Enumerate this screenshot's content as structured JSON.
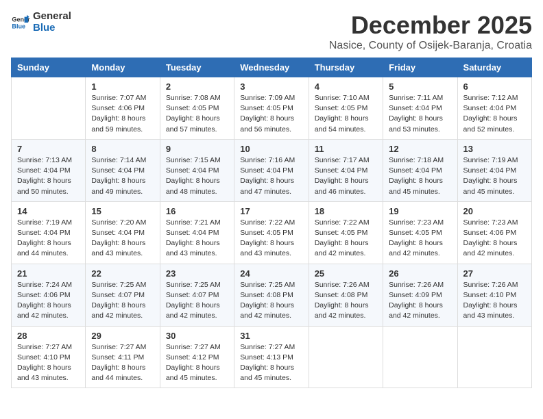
{
  "logo": {
    "line1": "General",
    "line2": "Blue"
  },
  "title": "December 2025",
  "subtitle": "Nasice, County of Osijek-Baranja, Croatia",
  "days_of_week": [
    "Sunday",
    "Monday",
    "Tuesday",
    "Wednesday",
    "Thursday",
    "Friday",
    "Saturday"
  ],
  "weeks": [
    [
      {
        "day": "",
        "info": ""
      },
      {
        "day": "1",
        "info": "Sunrise: 7:07 AM\nSunset: 4:06 PM\nDaylight: 8 hours\nand 59 minutes."
      },
      {
        "day": "2",
        "info": "Sunrise: 7:08 AM\nSunset: 4:05 PM\nDaylight: 8 hours\nand 57 minutes."
      },
      {
        "day": "3",
        "info": "Sunrise: 7:09 AM\nSunset: 4:05 PM\nDaylight: 8 hours\nand 56 minutes."
      },
      {
        "day": "4",
        "info": "Sunrise: 7:10 AM\nSunset: 4:05 PM\nDaylight: 8 hours\nand 54 minutes."
      },
      {
        "day": "5",
        "info": "Sunrise: 7:11 AM\nSunset: 4:04 PM\nDaylight: 8 hours\nand 53 minutes."
      },
      {
        "day": "6",
        "info": "Sunrise: 7:12 AM\nSunset: 4:04 PM\nDaylight: 8 hours\nand 52 minutes."
      }
    ],
    [
      {
        "day": "7",
        "info": "Sunrise: 7:13 AM\nSunset: 4:04 PM\nDaylight: 8 hours\nand 50 minutes."
      },
      {
        "day": "8",
        "info": "Sunrise: 7:14 AM\nSunset: 4:04 PM\nDaylight: 8 hours\nand 49 minutes."
      },
      {
        "day": "9",
        "info": "Sunrise: 7:15 AM\nSunset: 4:04 PM\nDaylight: 8 hours\nand 48 minutes."
      },
      {
        "day": "10",
        "info": "Sunrise: 7:16 AM\nSunset: 4:04 PM\nDaylight: 8 hours\nand 47 minutes."
      },
      {
        "day": "11",
        "info": "Sunrise: 7:17 AM\nSunset: 4:04 PM\nDaylight: 8 hours\nand 46 minutes."
      },
      {
        "day": "12",
        "info": "Sunrise: 7:18 AM\nSunset: 4:04 PM\nDaylight: 8 hours\nand 45 minutes."
      },
      {
        "day": "13",
        "info": "Sunrise: 7:19 AM\nSunset: 4:04 PM\nDaylight: 8 hours\nand 45 minutes."
      }
    ],
    [
      {
        "day": "14",
        "info": "Sunrise: 7:19 AM\nSunset: 4:04 PM\nDaylight: 8 hours\nand 44 minutes."
      },
      {
        "day": "15",
        "info": "Sunrise: 7:20 AM\nSunset: 4:04 PM\nDaylight: 8 hours\nand 43 minutes."
      },
      {
        "day": "16",
        "info": "Sunrise: 7:21 AM\nSunset: 4:04 PM\nDaylight: 8 hours\nand 43 minutes."
      },
      {
        "day": "17",
        "info": "Sunrise: 7:22 AM\nSunset: 4:05 PM\nDaylight: 8 hours\nand 43 minutes."
      },
      {
        "day": "18",
        "info": "Sunrise: 7:22 AM\nSunset: 4:05 PM\nDaylight: 8 hours\nand 42 minutes."
      },
      {
        "day": "19",
        "info": "Sunrise: 7:23 AM\nSunset: 4:05 PM\nDaylight: 8 hours\nand 42 minutes."
      },
      {
        "day": "20",
        "info": "Sunrise: 7:23 AM\nSunset: 4:06 PM\nDaylight: 8 hours\nand 42 minutes."
      }
    ],
    [
      {
        "day": "21",
        "info": "Sunrise: 7:24 AM\nSunset: 4:06 PM\nDaylight: 8 hours\nand 42 minutes."
      },
      {
        "day": "22",
        "info": "Sunrise: 7:25 AM\nSunset: 4:07 PM\nDaylight: 8 hours\nand 42 minutes."
      },
      {
        "day": "23",
        "info": "Sunrise: 7:25 AM\nSunset: 4:07 PM\nDaylight: 8 hours\nand 42 minutes."
      },
      {
        "day": "24",
        "info": "Sunrise: 7:25 AM\nSunset: 4:08 PM\nDaylight: 8 hours\nand 42 minutes."
      },
      {
        "day": "25",
        "info": "Sunrise: 7:26 AM\nSunset: 4:08 PM\nDaylight: 8 hours\nand 42 minutes."
      },
      {
        "day": "26",
        "info": "Sunrise: 7:26 AM\nSunset: 4:09 PM\nDaylight: 8 hours\nand 42 minutes."
      },
      {
        "day": "27",
        "info": "Sunrise: 7:26 AM\nSunset: 4:10 PM\nDaylight: 8 hours\nand 43 minutes."
      }
    ],
    [
      {
        "day": "28",
        "info": "Sunrise: 7:27 AM\nSunset: 4:10 PM\nDaylight: 8 hours\nand 43 minutes."
      },
      {
        "day": "29",
        "info": "Sunrise: 7:27 AM\nSunset: 4:11 PM\nDaylight: 8 hours\nand 44 minutes."
      },
      {
        "day": "30",
        "info": "Sunrise: 7:27 AM\nSunset: 4:12 PM\nDaylight: 8 hours\nand 45 minutes."
      },
      {
        "day": "31",
        "info": "Sunrise: 7:27 AM\nSunset: 4:13 PM\nDaylight: 8 hours\nand 45 minutes."
      },
      {
        "day": "",
        "info": ""
      },
      {
        "day": "",
        "info": ""
      },
      {
        "day": "",
        "info": ""
      }
    ]
  ]
}
